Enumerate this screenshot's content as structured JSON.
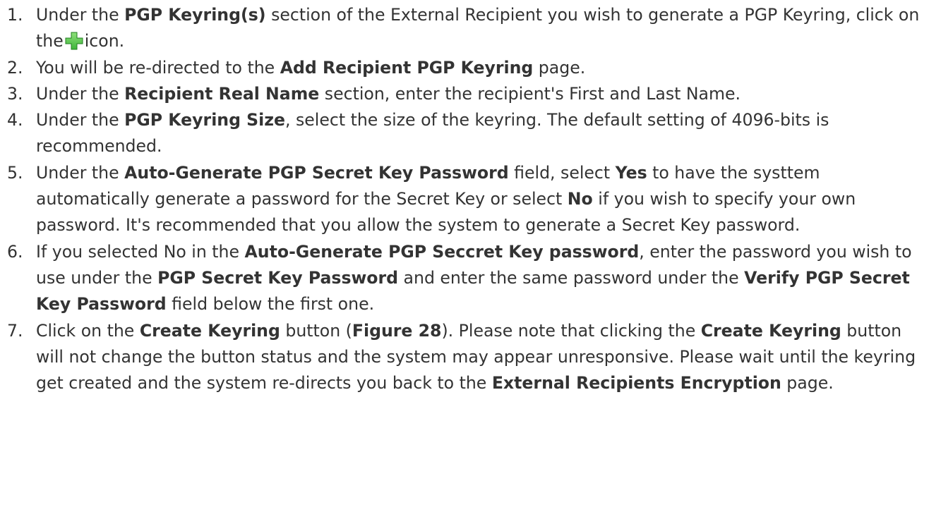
{
  "steps": [
    {
      "num": "1.",
      "parts": [
        {
          "t": "Under the "
        },
        {
          "t": "PGP Keyring(s)",
          "b": true
        },
        {
          "t": " section of the External Recipient you wish to generate a PGP Keyring, click on the"
        },
        {
          "icon": "add-icon"
        },
        {
          "t": "icon."
        }
      ]
    },
    {
      "num": "2.",
      "parts": [
        {
          "t": "You will be re-directed to the "
        },
        {
          "t": "Add Recipient PGP Keyring",
          "b": true
        },
        {
          "t": " page."
        }
      ]
    },
    {
      "num": "3.",
      "parts": [
        {
          "t": "Under the "
        },
        {
          "t": "Recipient Real Name",
          "b": true
        },
        {
          "t": " section, enter the recipient's First and Last Name."
        }
      ]
    },
    {
      "num": "4.",
      "parts": [
        {
          "t": "Under the "
        },
        {
          "t": "PGP Keyring Size",
          "b": true
        },
        {
          "t": ", select the size of the keyring. The default setting of 4096-bits is recommended."
        }
      ]
    },
    {
      "num": "5.",
      "parts": [
        {
          "t": "Under the "
        },
        {
          "t": "Auto-Generate PGP Secret Key Password",
          "b": true
        },
        {
          "t": " field, select "
        },
        {
          "t": "Yes",
          "b": true
        },
        {
          "t": " to have the systtem automatically generate a password for the Secret Key or select "
        },
        {
          "t": "No",
          "b": true
        },
        {
          "t": " if you wish to specify your own password. It's recommended that you allow the system to generate a Secret Key password."
        }
      ]
    },
    {
      "num": "6.",
      "parts": [
        {
          "t": "If you selected No in the "
        },
        {
          "t": "Auto-Generate PGP Seccret Key password",
          "b": true
        },
        {
          "t": ", enter the password you wish to use under the "
        },
        {
          "t": "PGP Secret Key Password",
          "b": true
        },
        {
          "t": " and enter the same password under the "
        },
        {
          "t": "Verify PGP Secret Key Password",
          "b": true
        },
        {
          "t": " field below the first one."
        }
      ]
    },
    {
      "num": "7.",
      "parts": [
        {
          "t": "Click on the "
        },
        {
          "t": "Create Keyring",
          "b": true
        },
        {
          "t": " button ("
        },
        {
          "t": "Figure 28",
          "b": true
        },
        {
          "t": "). Please note that clicking the "
        },
        {
          "t": "Create Keyring",
          "b": true
        },
        {
          "t": " button will not change the button status and the system may appear unresponsive. Please wait until the keyring get created and the system re-directs you back to the "
        },
        {
          "t": "External Recipients Encryption",
          "b": true
        },
        {
          "t": " page."
        }
      ]
    }
  ],
  "colors": {
    "text": "#333333",
    "icon_green": "#3db53a",
    "icon_green_light": "#8fe07a",
    "icon_green_dark": "#1f7d1f"
  }
}
